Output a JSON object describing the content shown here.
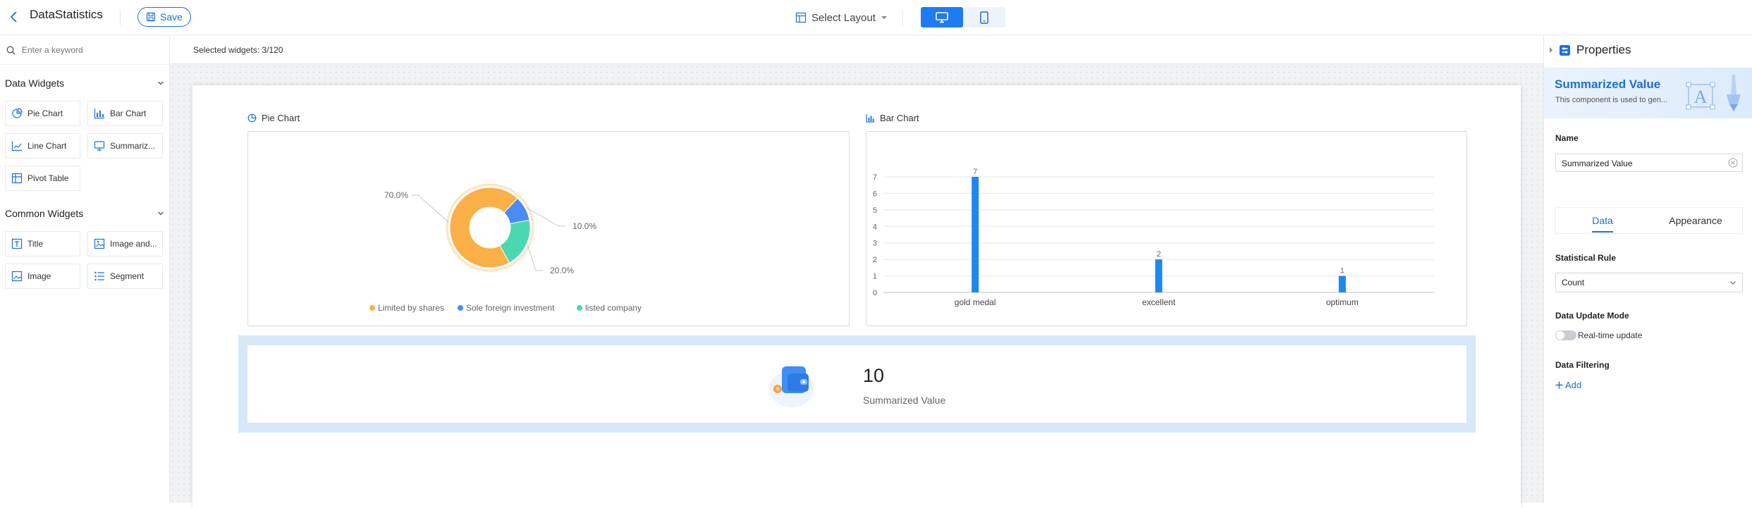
{
  "header": {
    "app_title": "DataStatistics",
    "save_label": "Save",
    "layout_label": "Select Layout"
  },
  "left_panel": {
    "search_placeholder": "Enter a keyword",
    "groups": [
      {
        "title": "Data Widgets",
        "items": [
          {
            "label": "Pie Chart",
            "icon": "pie-chart-icon"
          },
          {
            "label": "Bar Chart",
            "icon": "bar-chart-icon"
          },
          {
            "label": "Line Chart",
            "icon": "line-chart-icon"
          },
          {
            "label": "Summarized Value",
            "icon": "summarized-value-icon"
          },
          {
            "label": "Pivot Table",
            "icon": "pivot-table-icon"
          }
        ]
      },
      {
        "title": "Common Widgets",
        "items": [
          {
            "label": "Title",
            "icon": "title-icon"
          },
          {
            "label": "Image and Text",
            "icon": "image-text-icon"
          },
          {
            "label": "Image",
            "icon": "image-icon"
          },
          {
            "label": "Segment",
            "icon": "segment-icon"
          }
        ]
      }
    ]
  },
  "canvas": {
    "selected_count": "Selected widgets: 3/120",
    "pie_title": "Pie Chart",
    "bar_title": "Bar Chart",
    "summary": {
      "value": "10",
      "label": "Summarized Value"
    }
  },
  "colors": {
    "accent": "#1e6fdc",
    "pie_orange": "#fbaf47",
    "pie_blue": "#4b8bf5",
    "pie_green": "#4bd8b0",
    "bar_blue": "#1e87f0"
  },
  "chart_data": [
    {
      "type": "pie",
      "title": "Pie Chart",
      "donut": true,
      "slices": [
        {
          "name": "Limited by shares",
          "value": 70.0,
          "label": "70.0%",
          "color": "#fbaf47"
        },
        {
          "name": "Sole foreign investment",
          "value": 10.0,
          "label": "10.0%",
          "color": "#4b8bf5"
        },
        {
          "name": "listed company",
          "value": 20.0,
          "label": "20.0%",
          "color": "#4bd8b0"
        }
      ],
      "legend": "bottom"
    },
    {
      "type": "bar",
      "title": "Bar Chart",
      "categories": [
        "gold medal",
        "excellent",
        "optimum"
      ],
      "values": [
        7,
        2,
        1
      ],
      "ylim": [
        0,
        7
      ],
      "yticks": [
        "0",
        "1",
        "2",
        "3",
        "4",
        "5",
        "6",
        "7"
      ],
      "grid": true,
      "data_labels": true,
      "color": "#1e87f0"
    }
  ],
  "right_panel": {
    "title": "Properties",
    "banner_title": "Summarized Value",
    "banner_desc": "This component is used to gen...",
    "name_label": "Name",
    "name_value": "Summarized Value",
    "tabs": [
      "Data",
      "Appearance"
    ],
    "active_tab": "Data",
    "rule_label": "Statistical Rule",
    "rule_value": "Count",
    "update_label": "Data Update Mode",
    "update_option": "Real-time update",
    "realtime_enabled": false,
    "filter_label": "Data Filtering",
    "add_label": "Add"
  }
}
